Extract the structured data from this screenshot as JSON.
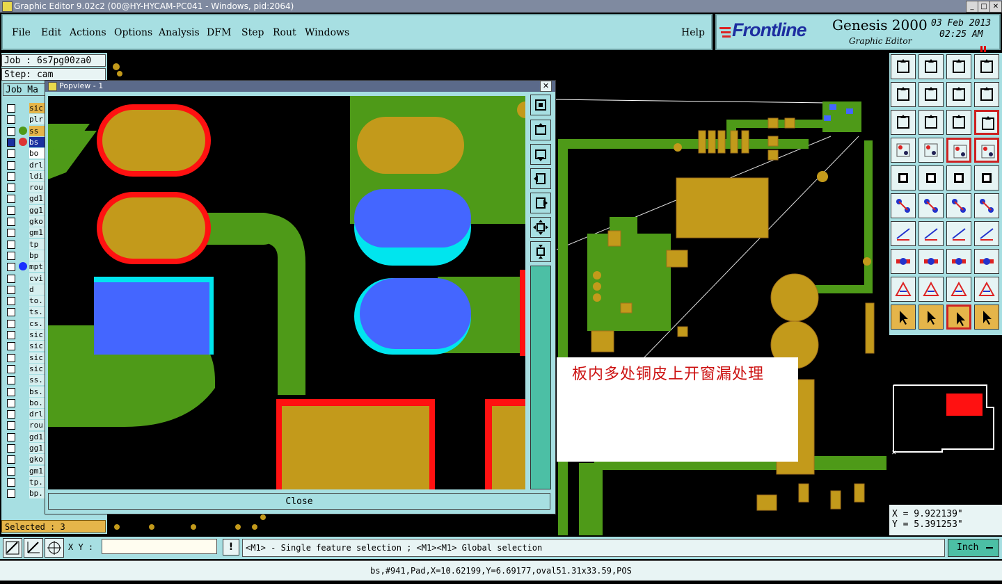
{
  "window": {
    "title": "Graphic Editor 9.02c2 (00@HY-HYCAM-PC041 - Windows, pid:2064)"
  },
  "menu": {
    "items": [
      "File",
      "Edit",
      "Actions",
      "Options",
      "Analysis",
      "DFM",
      "Step",
      "Rout",
      "Windows"
    ],
    "help": "Help"
  },
  "brand": {
    "logo": "Frontline",
    "product": "Genesis 2000",
    "subtitle": "Graphic Editor",
    "date": "03 Feb 2013",
    "time": "02:25 AM"
  },
  "job": {
    "job_label": "Job : 6s7pg00za0",
    "step_label": "Step: cam",
    "job_matrix_button": "Job Ma"
  },
  "layers": [
    "sic",
    "plr",
    "ss",
    "bs",
    "bo",
    "drl",
    "ldi",
    "rou",
    "gd1",
    "gg1",
    "gko",
    "gm1",
    "tp",
    "bp",
    "mpt",
    "cvi",
    "d",
    "to.",
    "ts.",
    "cs.",
    "sic",
    "sic",
    "sic",
    "sic",
    "ss.",
    "bs.",
    "bo.",
    "drl",
    "rou",
    "gd1",
    "gg1",
    "gko",
    "gm1",
    "tp.",
    "bp."
  ],
  "selected": "Selected : 3",
  "popview": {
    "title": "Popview - 1",
    "close_label": "Close"
  },
  "annotation": {
    "text": "板内多处铜皮上开窗漏处理"
  },
  "coords": {
    "x": "X = 9.922139\"",
    "y": "Y = 5.391253\""
  },
  "bottom": {
    "xy_label": "X Y :",
    "xy_value": "",
    "hint": "<M1> - Single feature selection ; <M1><M1> Global selection",
    "units": "Inch"
  },
  "status": {
    "text": "bs,#941,Pad,X=10.62199,Y=6.69177,oval51.31x33.59,POS"
  },
  "toolbar_icons": [
    "zoom-home-icon",
    "zoom-in-icon",
    "home-icon",
    "window-split-icon",
    "pan-left-icon",
    "pan-right-icon",
    "scale-icon",
    "mirror-icon",
    "fit-icon",
    "zoom-fit-icon",
    "one-to-two-icon",
    "help-icon",
    "measure-icon",
    "grid-icon",
    "layer-view-icon",
    "layer-red-icon",
    "add-pad-icon",
    "add-shape-icon",
    "ruler-icon",
    "snap-icon",
    "net-icon",
    "cross-icon",
    "line-red-icon",
    "line-blue-icon",
    "angle-icon",
    "diag-line-icon",
    "rotate-icon",
    "split-icon",
    "pad-icon",
    "line-icon",
    "dimension-icon",
    "pads-icon",
    "tri-red-icon",
    "tri-blue-icon",
    "tri-orange-icon",
    "tri-cross-icon",
    "select-icon",
    "select-box-icon",
    "select-arrow-icon",
    "select-net-icon"
  ],
  "colors": {
    "panel": "#a7dfe2",
    "copper": "#c39a1b",
    "green": "#4e9a18",
    "blue": "#4466ff",
    "red": "#ff1111",
    "cyan": "#00e5ee"
  }
}
